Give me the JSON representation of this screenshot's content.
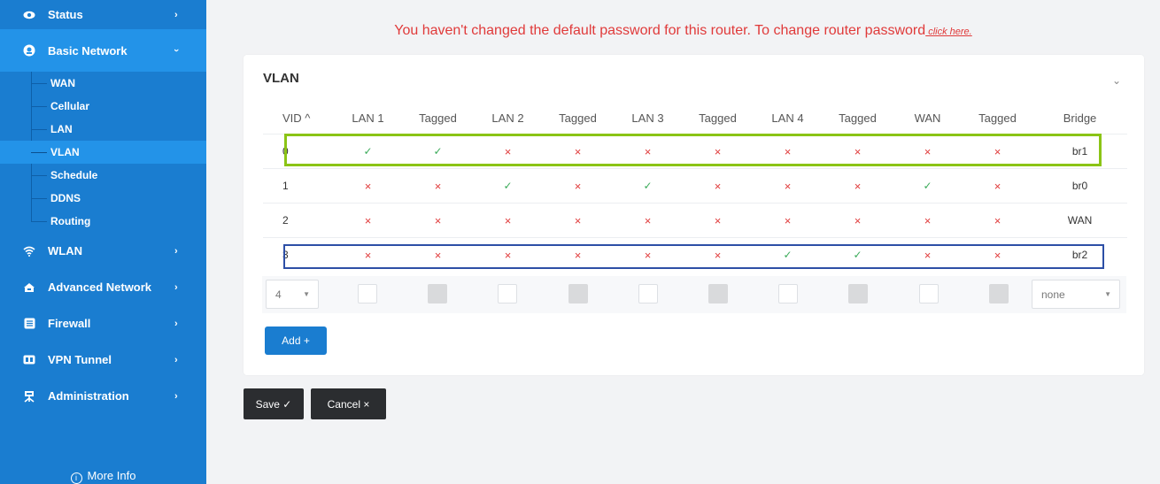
{
  "sidebar": {
    "items": [
      {
        "label": "Status",
        "icon": "eye-icon"
      },
      {
        "label": "Basic Network",
        "icon": "globe-icon"
      },
      {
        "label": "WLAN",
        "icon": "wifi-icon"
      },
      {
        "label": "Advanced Network",
        "icon": "network-icon"
      },
      {
        "label": "Firewall",
        "icon": "shield-icon"
      },
      {
        "label": "VPN Tunnel",
        "icon": "vpn-icon"
      },
      {
        "label": "Administration",
        "icon": "admin-icon"
      }
    ],
    "subitems": [
      "WAN",
      "Cellular",
      "LAN",
      "VLAN",
      "Schedule",
      "DDNS",
      "Routing"
    ],
    "active_subitem": "VLAN",
    "more_info": "More Info"
  },
  "banner": {
    "message": "You haven't changed the default password for this router. To change router password",
    "link": " click here."
  },
  "panel": {
    "title": "VLAN"
  },
  "table": {
    "headers": [
      "VID ^",
      "LAN 1",
      "Tagged",
      "LAN 2",
      "Tagged",
      "LAN 3",
      "Tagged",
      "LAN 4",
      "Tagged",
      "WAN",
      "Tagged",
      "Bridge"
    ],
    "rows": [
      {
        "vid": "0",
        "cells": [
          "✓",
          "✓",
          "×",
          "×",
          "×",
          "×",
          "×",
          "×",
          "×",
          "×"
        ],
        "bridge": "br1"
      },
      {
        "vid": "1",
        "cells": [
          "×",
          "×",
          "✓",
          "×",
          "✓",
          "×",
          "×",
          "×",
          "✓",
          "×"
        ],
        "bridge": "br0"
      },
      {
        "vid": "2",
        "cells": [
          "×",
          "×",
          "×",
          "×",
          "×",
          "×",
          "×",
          "×",
          "×",
          "×"
        ],
        "bridge": "WAN"
      },
      {
        "vid": "3",
        "cells": [
          "×",
          "×",
          "×",
          "×",
          "×",
          "×",
          "✓",
          "✓",
          "×",
          "×"
        ],
        "bridge": "br2"
      }
    ]
  },
  "editor": {
    "vid_value": "4",
    "bridge_value": "none",
    "add_label": "Add +"
  },
  "actions": {
    "save_label": "Save ✓",
    "cancel_label": "Cancel ×"
  },
  "colors": {
    "sidebar": "#1a7dd0",
    "sidebar_active": "#2393e8",
    "warning": "#e03a3a",
    "check": "#3cab5a",
    "highlight_green": "#8bc416",
    "highlight_blue": "#2d4fa6"
  }
}
